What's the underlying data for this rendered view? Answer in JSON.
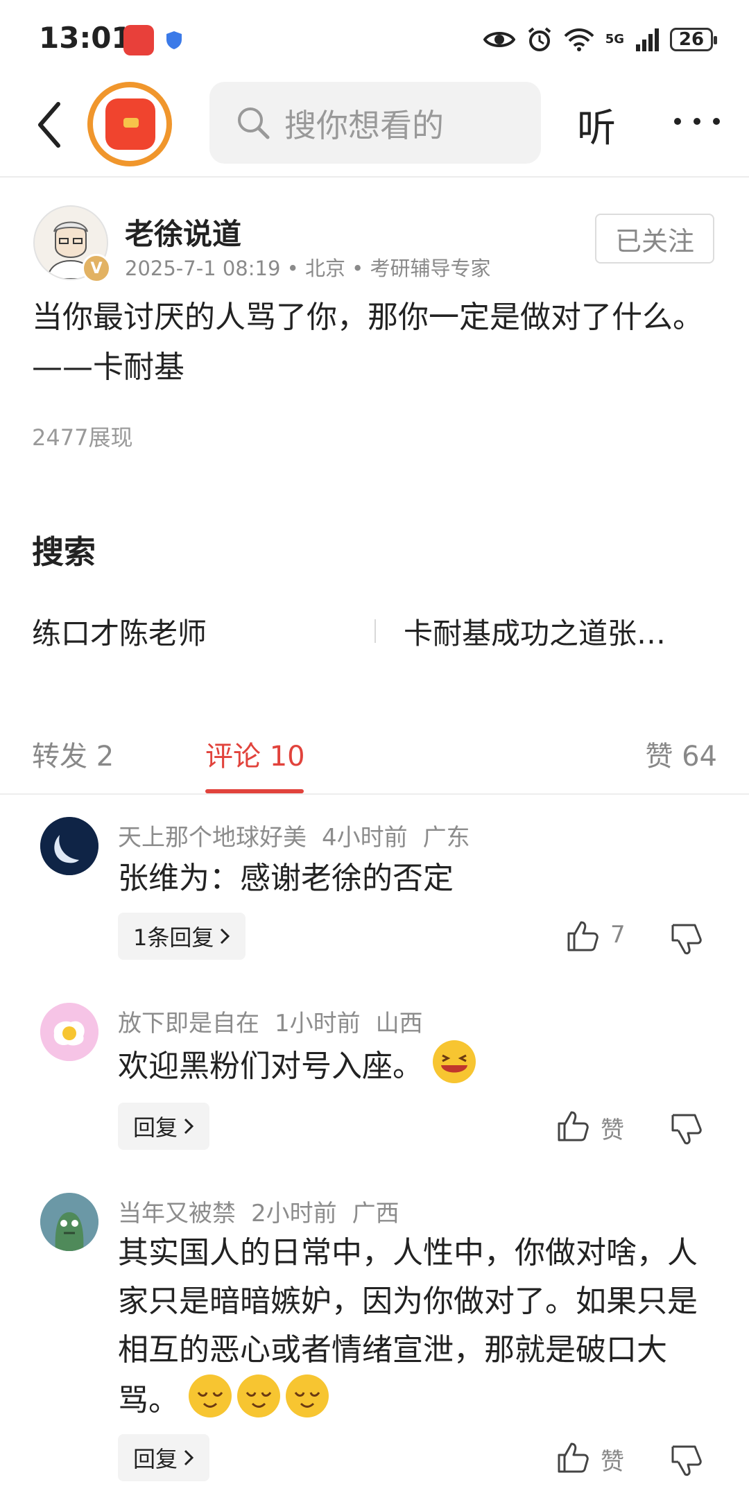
{
  "status": {
    "time": "13:01",
    "network": "5G",
    "battery": "26"
  },
  "nav": {
    "search_placeholder": "搜你想看的",
    "listen_label": "听"
  },
  "post": {
    "author": "老徐说道",
    "meta": "2025-7-1 08:19 • 北京 • 考研辅导专家",
    "follow_label": "已关注",
    "text": "当你最讨厌的人骂了你，那你一定是做对了什么。——卡耐基",
    "views": "2477展现"
  },
  "search_section": {
    "heading": "搜索",
    "suggestions": [
      "练口才陈老师",
      "卡耐基成功之道张…"
    ]
  },
  "tabs": {
    "repost": "转发 2",
    "comments": "评论 10",
    "likes": "赞 64"
  },
  "comments": [
    {
      "user": "天上那个地球好美",
      "time": "4小时前",
      "location": "广东",
      "text": "张维为：感谢老徐的否定",
      "reply_label": "1条回复",
      "likes": "7"
    },
    {
      "user": "放下即是自在",
      "time": "1小时前",
      "location": "山西",
      "text": "欢迎黑粉们对号入座。",
      "reply_label": "回复",
      "likes": "赞"
    },
    {
      "user": "当年又被禁",
      "time": "2小时前",
      "location": "广西",
      "text": "其实国人的日常中，人性中，你做对啥，人家只是暗暗嫉妒，因为你做对了。如果只是相互的恶心或者情绪宣泄，那就是破口大骂。",
      "reply_label": "回复",
      "likes": "赞"
    }
  ],
  "colors": {
    "accent": "#e1433c",
    "muted": "#8c8c8c",
    "orange_ring": "#f0962c"
  }
}
